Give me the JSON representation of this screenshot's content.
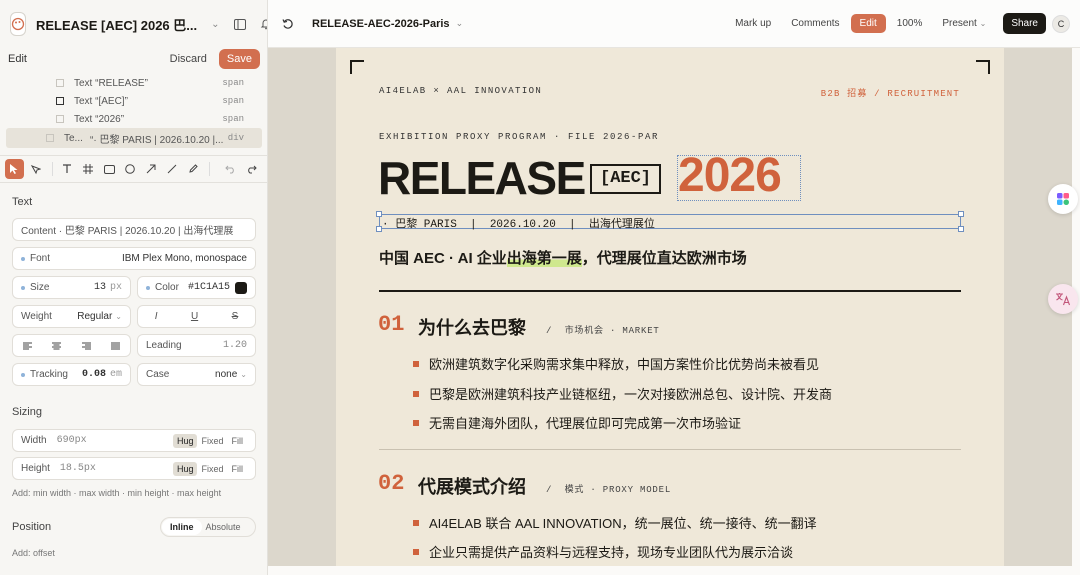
{
  "project": {
    "title": "RELEASE [AEC] 2026 巴..."
  },
  "edit_bar": {
    "label": "Edit",
    "discard": "Discard",
    "save": "Save"
  },
  "layers": [
    {
      "type": "Text",
      "text": "“RELEASE”",
      "tag": "span"
    },
    {
      "type": "Text",
      "text": "“[AEC]”",
      "tag": "span"
    },
    {
      "type": "Text",
      "text": "“2026”",
      "tag": "span"
    },
    {
      "type": "Te...",
      "text": "“· 巴黎 PARIS | 2026.10.20 |...",
      "tag": "div"
    }
  ],
  "text_panel": {
    "title": "Text",
    "content": "Content · 巴黎 PARIS | 2026.10.20 | 出海代理展",
    "font_label": "Font",
    "font_value": "IBM Plex Mono, monospace",
    "size_label": "Size",
    "size_value": "13",
    "size_unit": "px",
    "color_label": "Color",
    "color_value": "#1C1A15",
    "weight_label": "Weight",
    "weight_value": "Regular",
    "style_italic": "I",
    "style_underline": "U",
    "style_strike": "S",
    "leading_label": "Leading",
    "leading_value": "1.20",
    "tracking_label": "Tracking",
    "tracking_value": "0.08",
    "tracking_unit": "em",
    "case_label": "Case",
    "case_value": "none"
  },
  "sizing": {
    "title": "Sizing",
    "width_label": "Width",
    "width_value": "690px",
    "height_label": "Height",
    "height_value": "18.5px",
    "opt_hug": "Hug",
    "opt_fixed": "Fixed",
    "opt_fill": "Fill",
    "hint": "Add: min width · max width · min height · max height"
  },
  "position": {
    "title": "Position",
    "opt_inline": "Inline",
    "opt_absolute": "Absolute",
    "hint": "Add: offset"
  },
  "topbar": {
    "file": "RELEASE-AEC-2026-Paris",
    "markup": "Mark up",
    "comments": "Comments",
    "edit": "Edit",
    "zoom": "100%",
    "present": "Present",
    "share": "Share",
    "avatar": "C"
  },
  "doc": {
    "brand_left": "AI4ELAB  ×  AAL INNOVATION",
    "brand_right": "B2B 招募 / RECRUITMENT",
    "kicker": "EXHIBITION PROXY PROGRAM · FILE 2026-PAR",
    "release": "RELEASE",
    "aec": "[AEC]",
    "year": "2026",
    "meta": "· 巴黎 PARIS  |  2026.10.20  |  出海代理展位",
    "subhead_pre": "中国 AEC · AI 企业",
    "subhead_hl": "出海第一展",
    "subhead_post": "，代理展位直达欧洲市场",
    "sections": [
      {
        "num": "01",
        "name": "为什么去巴黎",
        "tag": "/  市场机会 · MARKET",
        "bullets": [
          "欧洲建筑数字化采购需求集中释放，中国方案性价比优势尚未被看见",
          "巴黎是欧洲建筑科技产业链枢纽，一次对接欧洲总包、设计院、开发商",
          "无需自建海外团队，代理展位即可完成第一次市场验证"
        ]
      },
      {
        "num": "02",
        "name": "代展模式介绍",
        "tag": "/  模式 · PROXY MODEL",
        "bullets": [
          "AI4ELAB 联合 AAL INNOVATION，统一展位、统一接待、统一翻译",
          "企业只需提供产品资料与远程支持，现场专业团队代为展示洽谈"
        ]
      }
    ]
  },
  "colors": {
    "accent": "#d0623c",
    "ink": "#1c1a15",
    "paper": "#efe8d9",
    "selection": "#6f8fbf"
  },
  "icons": [
    "palette-icon",
    "chevron-down-icon",
    "sidebar-icon",
    "bell-icon",
    "pointer-icon",
    "pen-icon",
    "text-icon",
    "grid-icon",
    "rect-icon",
    "circle-icon",
    "arrow-icon",
    "line-icon",
    "pencil-icon",
    "undo-icon",
    "redo-icon",
    "refresh-icon",
    "app-switch-icon",
    "translate-icon"
  ]
}
